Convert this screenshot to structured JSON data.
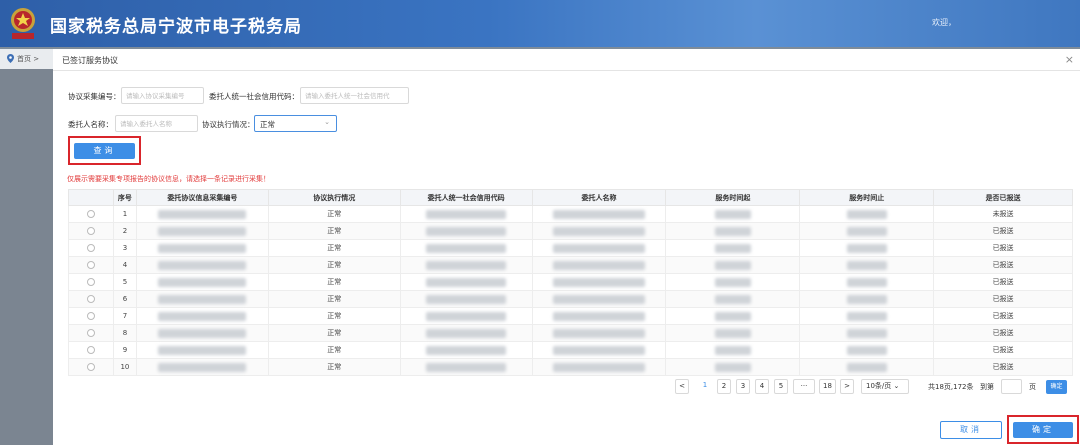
{
  "header": {
    "title": "国家税务总局宁波市电子税务局",
    "welcome": "欢迎，"
  },
  "breadcrumb": {
    "home": "首页 >"
  },
  "modal": {
    "title": "已签订服务协议",
    "close": "×"
  },
  "form": {
    "collect_no_label": "协议采集编号：",
    "collect_no_placeholder": "请输入协议采集编号",
    "credit_code_label": "委托人统一社会信用代码：",
    "credit_code_placeholder": "请输入委托人统一社会信用代",
    "client_name_label": "委托人名称：",
    "client_name_placeholder": "请输入委托人名称",
    "status_label": "协议执行情况：",
    "status_value": "正常",
    "query_label": "查询"
  },
  "notice": "仅展示需要采集专项报告的协议信息，请选择一条记录进行采集！",
  "table": {
    "headers": [
      "",
      "序号",
      "委托协议信息采集编号",
      "协议执行情况",
      "委托人统一社会信用代码",
      "委托人名称",
      "服务时间起",
      "服务时间止",
      "是否已报送"
    ],
    "rows": [
      {
        "no": "1",
        "status": "正常",
        "sent": "未报送"
      },
      {
        "no": "2",
        "status": "正常",
        "sent": "已报送"
      },
      {
        "no": "3",
        "status": "正常",
        "sent": "已报送"
      },
      {
        "no": "4",
        "status": "正常",
        "sent": "已报送"
      },
      {
        "no": "5",
        "status": "正常",
        "sent": "已报送"
      },
      {
        "no": "6",
        "status": "正常",
        "sent": "已报送"
      },
      {
        "no": "7",
        "status": "正常",
        "sent": "已报送"
      },
      {
        "no": "8",
        "status": "正常",
        "sent": "已报送"
      },
      {
        "no": "9",
        "status": "正常",
        "sent": "已报送"
      },
      {
        "no": "10",
        "status": "正常",
        "sent": "已报送"
      }
    ]
  },
  "pagination": {
    "prev": "<",
    "pages": [
      "1",
      "2",
      "3",
      "4",
      "5",
      "···",
      "18"
    ],
    "next": ">",
    "page_size": "10条/页",
    "summary": "共18页,172条",
    "goto_label": "到第",
    "page_unit": "页",
    "go_button": "确定"
  },
  "footer": {
    "cancel": "取消",
    "confirm": "确定"
  },
  "colors": {
    "primary": "#3d8ee6",
    "highlight_border": "#d9252b",
    "notice": "#e23b3b"
  }
}
